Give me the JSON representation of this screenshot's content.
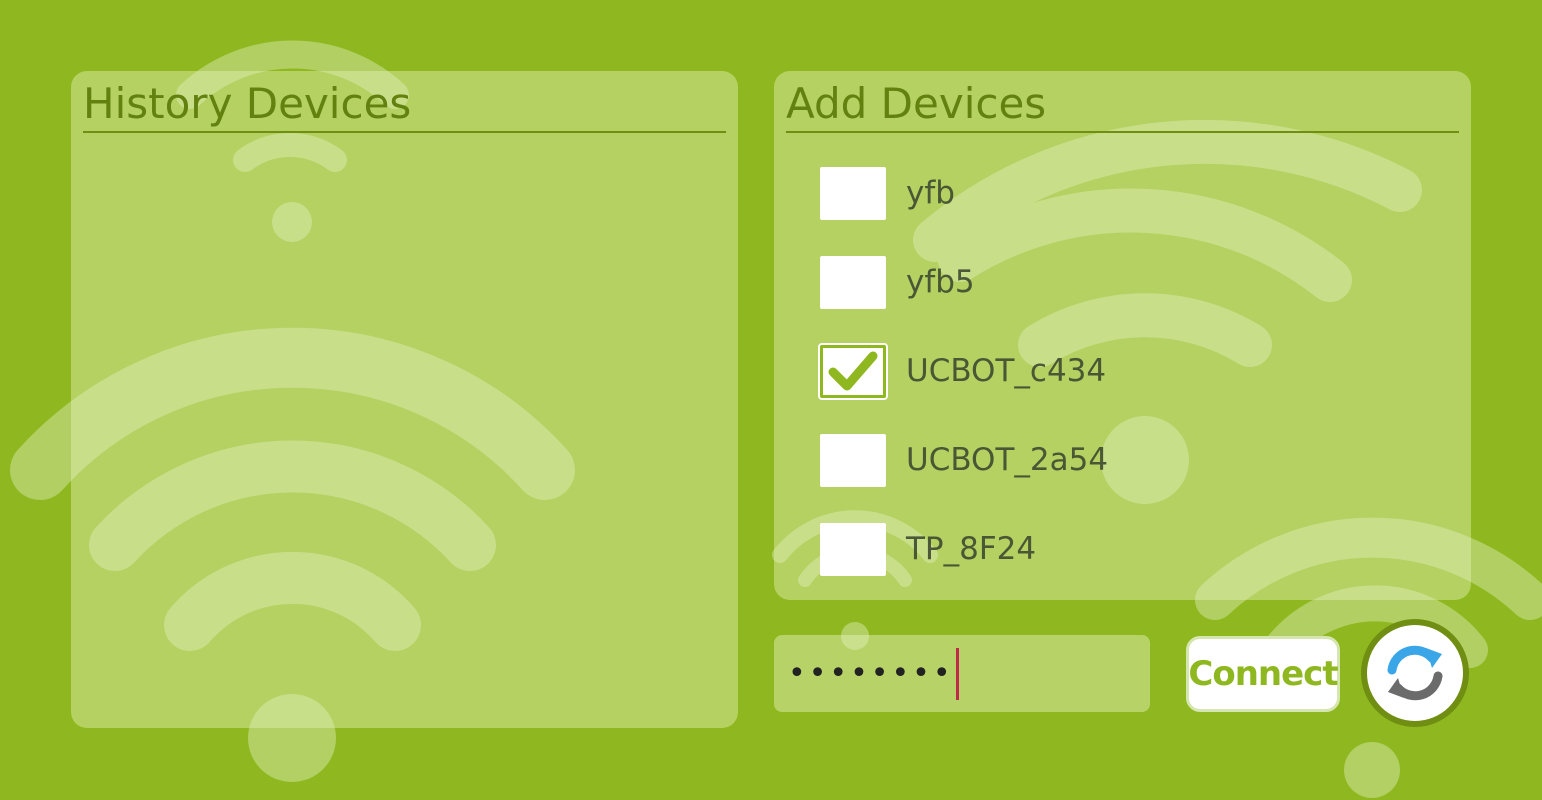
{
  "history_panel": {
    "title": "History Devices"
  },
  "add_panel": {
    "title": "Add Devices",
    "devices": [
      {
        "label": "yfb",
        "checked": false
      },
      {
        "label": "yfb5",
        "checked": false
      },
      {
        "label": "UCBOT_c434",
        "checked": true
      },
      {
        "label": "UCBOT_2a54",
        "checked": false
      },
      {
        "label": "TP_8F24",
        "checked": false
      }
    ]
  },
  "password": {
    "masked_value": "••••••••"
  },
  "connect_button": {
    "label": "Connect"
  },
  "refresh_button": {
    "icon": "refresh-icon"
  },
  "colors": {
    "background": "#8fb820",
    "accent_dark": "#6f8e12",
    "refresh_blue": "#3aa6e8",
    "refresh_gray": "#6b6b6b"
  }
}
